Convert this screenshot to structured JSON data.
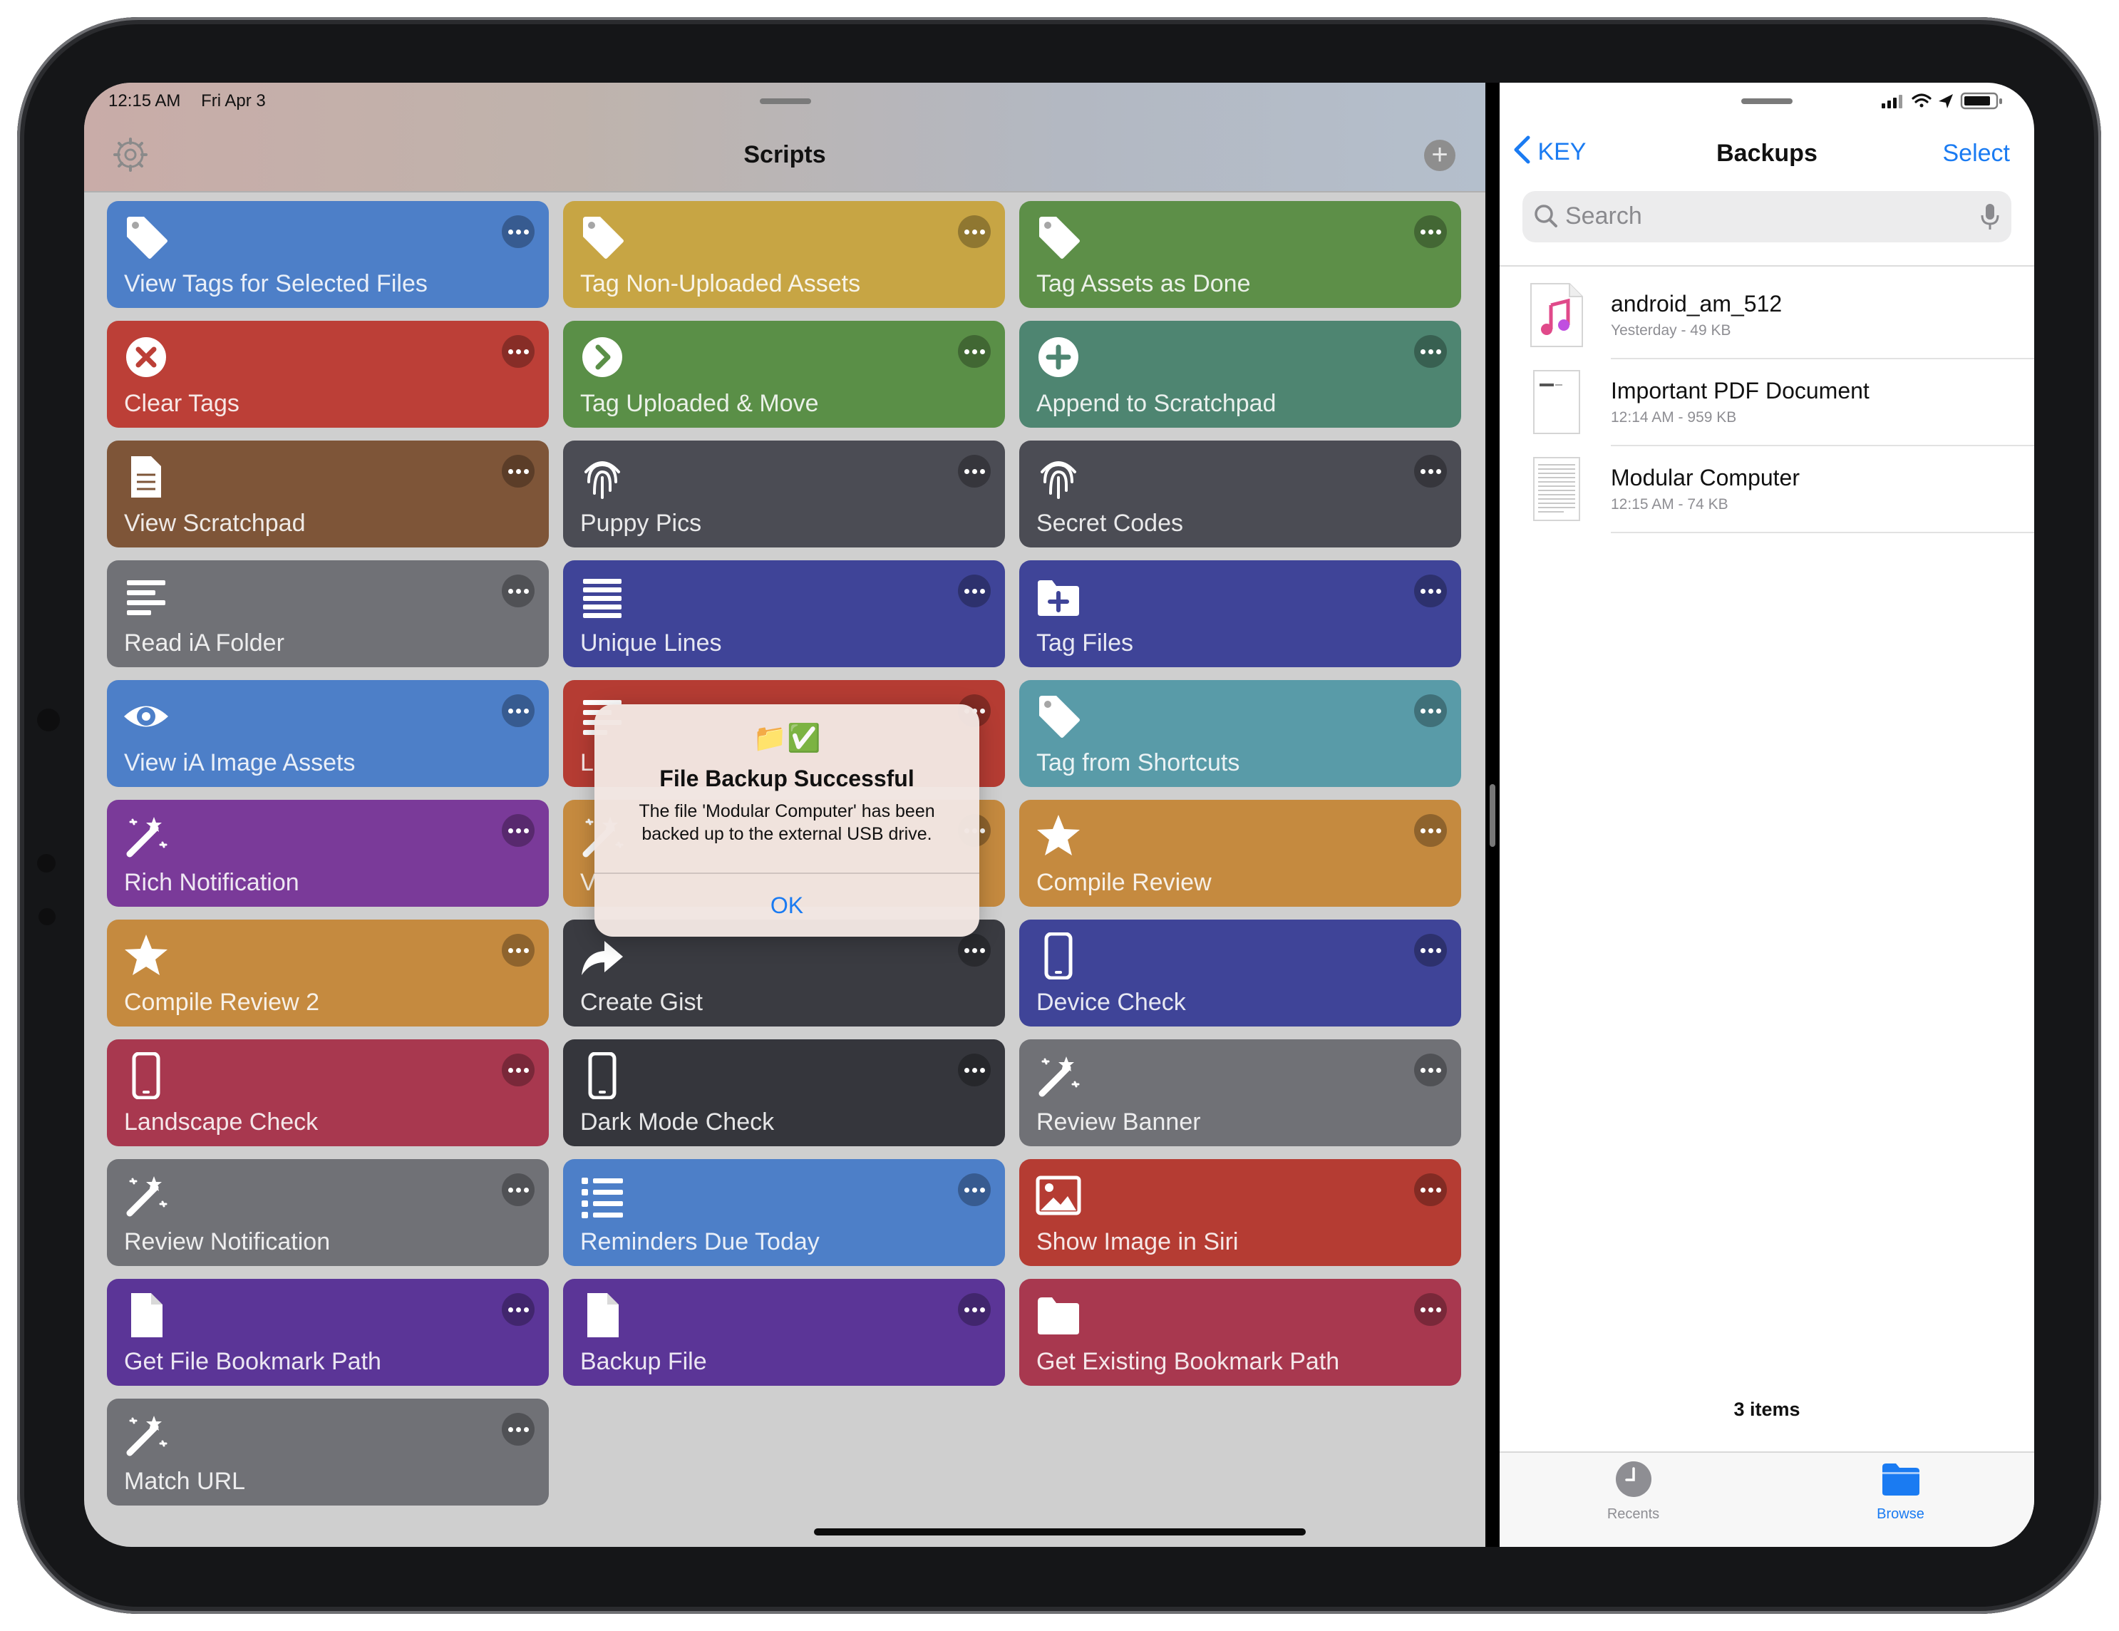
{
  "statusbar": {
    "time": "12:15 AM",
    "date": "Fri Apr 3"
  },
  "scripts": {
    "title": "Scripts",
    "tiles": [
      {
        "label": "View Tags for Selected Files",
        "color": "#4d7fc8",
        "icon": "tag-icon"
      },
      {
        "label": "Tag Non-Uploaded Assets",
        "color": "#c7a544",
        "icon": "tag-icon"
      },
      {
        "label": "Tag Assets as Done",
        "color": "#5d8f48",
        "icon": "tag-icon"
      },
      {
        "label": "Clear Tags",
        "color": "#bc3f37",
        "icon": "x-circle-icon"
      },
      {
        "label": "Tag Uploaded & Move",
        "color": "#5a8f47",
        "icon": "chevron-circle-icon"
      },
      {
        "label": "Append to Scratchpad",
        "color": "#4e8571",
        "icon": "plus-circle-icon"
      },
      {
        "label": "View Scratchpad",
        "color": "#7e5538",
        "icon": "document-icon"
      },
      {
        "label": "Puppy Pics",
        "color": "#4b4c54",
        "icon": "fingerprint-icon"
      },
      {
        "label": "Secret Codes",
        "color": "#4b4c54",
        "icon": "fingerprint-icon"
      },
      {
        "label": "Read iA Folder",
        "color": "#707176",
        "icon": "text-lines-icon"
      },
      {
        "label": "Unique Lines",
        "color": "#3f4498",
        "icon": "list-lines-icon"
      },
      {
        "label": "Tag Files",
        "color": "#3f4498",
        "icon": "folder-plus-icon"
      },
      {
        "label": "View iA Image Assets",
        "color": "#4d7fc8",
        "icon": "eye-icon"
      },
      {
        "label": "Tag from Shortcuts",
        "color": "#599ba8",
        "icon": "tag-icon"
      },
      {
        "label": "Rich Notification",
        "color": "#7a3a99",
        "icon": "magic-wand-icon"
      },
      {
        "label": "Compile Review",
        "color": "#c58a3f",
        "icon": "star-icon"
      },
      {
        "label": "Compile Review 2",
        "color": "#c58a3f",
        "icon": "star-icon"
      },
      {
        "label": "Create Gist",
        "color": "#3a3b41",
        "icon": "share-arrow-icon"
      },
      {
        "label": "Device Check",
        "color": "#3f4498",
        "icon": "phone-icon"
      },
      {
        "label": "Landscape Check",
        "color": "#a8384f",
        "icon": "phone-icon"
      },
      {
        "label": "Dark Mode Check",
        "color": "#35363c",
        "icon": "phone-icon"
      },
      {
        "label": "Review Banner",
        "color": "#707176",
        "icon": "magic-wand-icon"
      },
      {
        "label": "Review Notification",
        "color": "#707176",
        "icon": "magic-wand-icon"
      },
      {
        "label": "Reminders Due Today",
        "color": "#4d7fc8",
        "icon": "checklist-icon"
      },
      {
        "label": "Show Image in Siri",
        "color": "#b53c33",
        "icon": "image-icon"
      },
      {
        "label": "Get File Bookmark Path",
        "color": "#5b3597",
        "icon": "file-icon"
      },
      {
        "label": "Backup File",
        "color": "#5b3597",
        "icon": "file-icon"
      },
      {
        "label": "Get Existing Bookmark Path",
        "color": "#a8384f",
        "icon": "folder-icon"
      },
      {
        "label": "Match URL",
        "color": "#707176",
        "icon": "magic-wand-icon"
      }
    ],
    "hidden_tiles": [
      {
        "label": "L",
        "color": "#b53c33",
        "icon": "text-lines-icon"
      },
      {
        "label": "V",
        "color": "#c58a3f",
        "icon": "magic-wand-icon"
      }
    ]
  },
  "alert": {
    "emoji": "📁✅",
    "title": "File Backup Successful",
    "message": "The file 'Modular Computer' has been backed up to the external USB drive.",
    "button": "OK"
  },
  "files": {
    "back_label": "KEY",
    "title": "Backups",
    "select_label": "Select",
    "search_placeholder": "Search",
    "items": [
      {
        "name": "android_am_512",
        "meta": "Yesterday - 49 KB",
        "icon": "music-file-icon"
      },
      {
        "name": "Important PDF Document",
        "meta": "12:14 AM - 959 KB",
        "icon": "pdf-thumbnail-icon"
      },
      {
        "name": "Modular Computer",
        "meta": "12:15 AM - 74 KB",
        "icon": "document-thumbnail-icon"
      }
    ],
    "count": "3 items",
    "tabs": [
      {
        "label": "Recents",
        "icon": "clock-icon",
        "active": false
      },
      {
        "label": "Browse",
        "icon": "folder-icon",
        "active": true
      }
    ]
  },
  "colors": {
    "accent": "#1a7bf2"
  }
}
